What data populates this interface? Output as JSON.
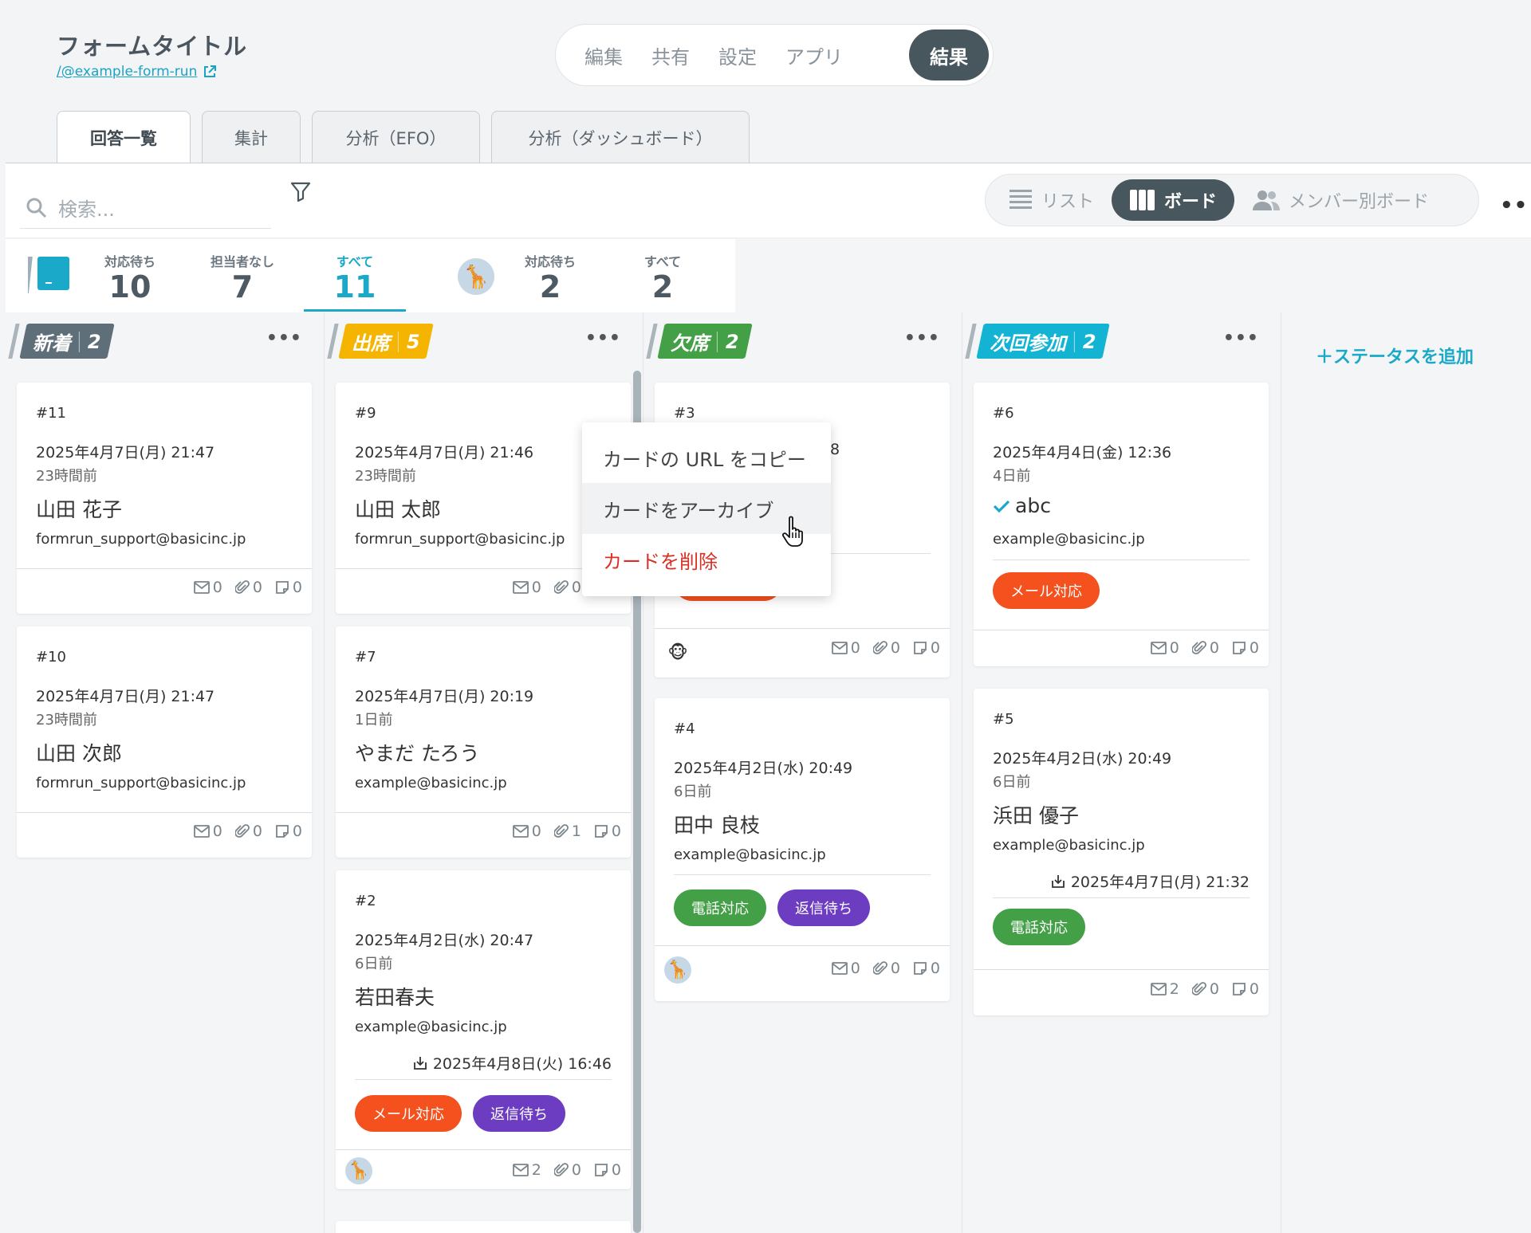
{
  "header": {
    "form_title": "フォームタイトル",
    "form_link": "/@example-form-run",
    "nav": [
      "編集",
      "共有",
      "設定",
      "アプリ",
      "結果"
    ],
    "nav_active": "結果"
  },
  "tabs": [
    "回答一覧",
    "集計",
    "分析（EFO）",
    "分析（ダッシュボード）"
  ],
  "toolbar": {
    "search_placeholder": "検索...",
    "views": [
      "リスト",
      "ボード",
      "メンバー別ボード"
    ],
    "active_view": "ボード"
  },
  "stats": {
    "team": [
      {
        "label": "対応待ち",
        "value": "10"
      },
      {
        "label": "担当者なし",
        "value": "7"
      },
      {
        "label": "すべて",
        "value": "11"
      }
    ],
    "member": [
      {
        "label": "対応待ち",
        "value": "2"
      },
      {
        "label": "すべて",
        "value": "2"
      }
    ],
    "box_label": "_"
  },
  "lanes": [
    {
      "name": "新着",
      "count": "2",
      "color": "#5f6f79"
    },
    {
      "name": "出席",
      "count": "5",
      "color": "#f5b400"
    },
    {
      "name": "欠席",
      "count": "2",
      "color": "#43a047"
    },
    {
      "name": "次回参加",
      "count": "2",
      "color": "#12b3d3"
    }
  ],
  "cards": {
    "c11": {
      "no": "#11",
      "date": "2025年4月7日(月) 21:47",
      "ago": "23時間前",
      "name": "山田 花子",
      "mail": "formrun_support@basicinc.jp",
      "m": "0",
      "a": "0",
      "n": "0"
    },
    "c10": {
      "no": "#10",
      "date": "2025年4月7日(月) 21:47",
      "ago": "23時間前",
      "name": "山田 次郎",
      "mail": "formrun_support@basicinc.jp",
      "m": "0",
      "a": "0",
      "n": "0"
    },
    "c9": {
      "no": "#9",
      "date": "2025年4月7日(月) 21:46",
      "ago": "23時間前",
      "name": "山田 太郎",
      "mail": "formrun_support@basicinc.jp",
      "m": "0",
      "a": "0",
      "n": "0"
    },
    "c7": {
      "no": "#7",
      "date": "2025年4月7日(月) 20:19",
      "ago": "1日前",
      "name": "やまだ たろう",
      "mail": "example@basicinc.jp",
      "m": "0",
      "a": "1",
      "n": "0"
    },
    "c2": {
      "no": "#2",
      "date": "2025年4月2日(水) 20:47",
      "ago": "6日前",
      "name": "若田春夫",
      "mail": "example@basicinc.jp",
      "due": "2025年4月8日(火) 16:46",
      "tags": [
        "メール対応",
        "返信待ち"
      ],
      "m": "2",
      "a": "0",
      "n": "0"
    },
    "c3": {
      "no": "#3",
      "date_tail": "8",
      "m": "0",
      "a": "0",
      "n": "0"
    },
    "c4": {
      "no": "#4",
      "date": "2025年4月2日(水) 20:49",
      "ago": "6日前",
      "name": "田中 良枝",
      "mail": "example@basicinc.jp",
      "tags": [
        "電話対応",
        "返信待ち"
      ],
      "m": "0",
      "a": "0",
      "n": "0"
    },
    "c6": {
      "no": "#6",
      "date": "2025年4月4日(金) 12:36",
      "ago": "4日前",
      "name": "abc",
      "mail": "example@basicinc.jp",
      "tags": [
        "メール対応"
      ],
      "m": "0",
      "a": "0",
      "n": "0"
    },
    "c5": {
      "no": "#5",
      "date": "2025年4月2日(水) 20:49",
      "ago": "6日前",
      "name": "浜田 優子",
      "mail": "example@basicinc.jp",
      "due": "2025年4月7日(月) 21:32",
      "tags": [
        "電話対応"
      ],
      "m": "2",
      "a": "0",
      "n": "0"
    }
  },
  "add_status": "＋ステータスを追加",
  "context_menu": [
    "カードの URL をコピー",
    "カードをアーカイブ",
    "カードを削除"
  ],
  "colors": {
    "accent": "#1aa9c9",
    "dark": "#48565e",
    "danger": "#d93025"
  }
}
